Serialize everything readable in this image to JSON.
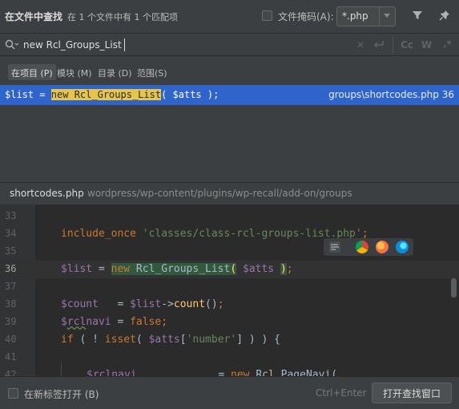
{
  "header": {
    "title": "在文件中查找",
    "match_summary": "在 1 个文件中有 1 个匹配项",
    "file_mask_label": "文件掩码(A):",
    "file_mask_value": "*.php"
  },
  "search": {
    "query": "new Rcl_Groups_List"
  },
  "scopes": [
    {
      "label": "在项目 (P)",
      "active": true
    },
    {
      "label": "模块 (M)",
      "active": false
    },
    {
      "label": "目录 (D)",
      "active": false
    },
    {
      "label": "范围(S)",
      "active": false
    }
  ],
  "results": [
    {
      "code_before": "$list = ",
      "code_match": "new Rcl_Groups_List",
      "code_after": "( $atts );",
      "location": "groups\\shortcodes.php 36"
    }
  ],
  "preview": {
    "file_name": "shortcodes.php",
    "file_path": "wordpress/wp-content/plugins/wp-recall/add-on/groups"
  },
  "editor": {
    "line_numbers": [
      "33",
      "34",
      "35",
      "36",
      "37",
      "38",
      "39",
      "40",
      "41",
      "42"
    ],
    "current_line": "36"
  },
  "footer": {
    "new_tab_label": "在新标签打开 (B)",
    "shortcut": "Ctrl+Enter",
    "open_button": "打开查找窗口"
  },
  "icons": {
    "filter": "filter-icon",
    "pin": "pin-icon",
    "search": "search-icon",
    "clear": "close-icon",
    "newline": "newline-icon",
    "match_case": "match-case-icon",
    "whole_words": "whole-words-icon",
    "regex": "regex-icon",
    "browsers": [
      "chrome-icon",
      "firefox-icon",
      "edge-icon"
    ]
  },
  "colors": {
    "selection": "#2f65ca",
    "match_highlight": "#e6c54a",
    "editor_bg": "#2b2b2b",
    "panel_bg": "#3c3f41"
  }
}
